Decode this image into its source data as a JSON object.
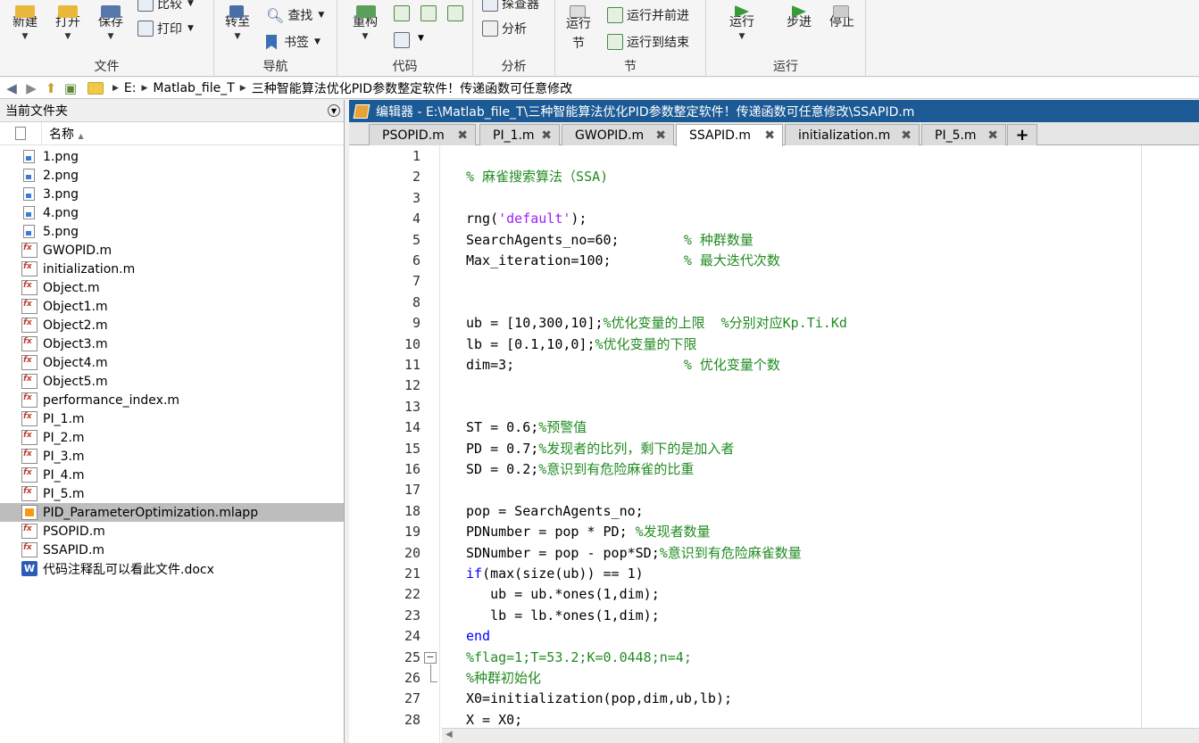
{
  "ribbon": {
    "groups": {
      "file": "文件",
      "navigate": "导航",
      "code": "代码",
      "analyze": "分析",
      "section": "节",
      "run": "运行"
    },
    "buttons": {
      "new": "新建",
      "open": "打开",
      "save": "保存",
      "compare": "比较",
      "print": "打印",
      "goto": "转至",
      "find": "查找",
      "bookmark": "书签",
      "refactor": "重构",
      "profiler": "探查器",
      "analyze": "分析",
      "run_section": "运行\n节",
      "run_advance": "运行并前进",
      "run_to_end": "运行到结束",
      "run": "运行",
      "step": "步进",
      "stop": "停止"
    }
  },
  "address": {
    "drive": "E:",
    "folder1": "Matlab_file_T",
    "folder2": "三种智能算法优化PID参数整定软件！传递函数可任意修改"
  },
  "left_panel": {
    "title": "当前文件夹",
    "name_col": "名称",
    "sort_indicator": "▲",
    "files": [
      {
        "name": "1.png",
        "type": "png"
      },
      {
        "name": "2.png",
        "type": "png"
      },
      {
        "name": "3.png",
        "type": "png"
      },
      {
        "name": "4.png",
        "type": "png"
      },
      {
        "name": "5.png",
        "type": "png"
      },
      {
        "name": "GWOPID.m",
        "type": "m"
      },
      {
        "name": "initialization.m",
        "type": "m"
      },
      {
        "name": "Object.m",
        "type": "m"
      },
      {
        "name": "Object1.m",
        "type": "m"
      },
      {
        "name": "Object2.m",
        "type": "m"
      },
      {
        "name": "Object3.m",
        "type": "m"
      },
      {
        "name": "Object4.m",
        "type": "m"
      },
      {
        "name": "Object5.m",
        "type": "m"
      },
      {
        "name": "performance_index.m",
        "type": "m"
      },
      {
        "name": "PI_1.m",
        "type": "m"
      },
      {
        "name": "PI_2.m",
        "type": "m"
      },
      {
        "name": "PI_3.m",
        "type": "m"
      },
      {
        "name": "PI_4.m",
        "type": "m"
      },
      {
        "name": "PI_5.m",
        "type": "m"
      },
      {
        "name": "PID_ParameterOptimization.mlapp",
        "type": "mlapp",
        "selected": true
      },
      {
        "name": "PSOPID.m",
        "type": "m"
      },
      {
        "name": "SSAPID.m",
        "type": "m"
      },
      {
        "name": "代码注释乱可以看此文件.docx",
        "type": "docx"
      }
    ]
  },
  "editor": {
    "title": "编辑器 - E:\\Matlab_file_T\\三种智能算法优化PID参数整定软件！传递函数可任意修改\\SSAPID.m",
    "tabs": [
      "PSOPID.m",
      "PI_1.m",
      "GWOPID.m",
      "SSAPID.m",
      "initialization.m",
      "PI_5.m"
    ],
    "active_tab": "SSAPID.m",
    "close_glyph": "✖",
    "add_tab": "+",
    "fold_glyph": "−",
    "line_numbers": [
      "1",
      "2",
      "3",
      "4",
      "5",
      "6",
      "7",
      "8",
      "9",
      "10",
      "11",
      "12",
      "13",
      "14",
      "15",
      "16",
      "17",
      "18",
      "19",
      "20",
      "21",
      "22",
      "23",
      "24",
      "25",
      "26",
      "27",
      "28"
    ],
    "code_lines": [
      [],
      [
        {
          "t": "% 麻雀搜索算法（SSA)",
          "c": "cm"
        }
      ],
      [],
      [
        {
          "t": "rng(",
          "c": ""
        },
        {
          "t": "'default'",
          "c": "str"
        },
        {
          "t": ");",
          "c": ""
        }
      ],
      [
        {
          "t": "SearchAgents_no=60;        ",
          "c": ""
        },
        {
          "t": "% 种群数量",
          "c": "cm"
        }
      ],
      [
        {
          "t": "Max_iteration=100;         ",
          "c": ""
        },
        {
          "t": "% 最大迭代次数",
          "c": "cm"
        }
      ],
      [],
      [],
      [
        {
          "t": "ub = [10,300,10];",
          "c": ""
        },
        {
          "t": "%优化变量的上限  %分别对应Kp.Ti.Kd",
          "c": "cm"
        }
      ],
      [
        {
          "t": "lb = [0.1,10,0];",
          "c": ""
        },
        {
          "t": "%优化变量的下限",
          "c": "cm"
        }
      ],
      [
        {
          "t": "dim=3;                     ",
          "c": ""
        },
        {
          "t": "% 优化变量个数",
          "c": "cm"
        }
      ],
      [],
      [],
      [
        {
          "t": "ST = 0.6;",
          "c": ""
        },
        {
          "t": "%预警值",
          "c": "cm"
        }
      ],
      [
        {
          "t": "PD = 0.7;",
          "c": ""
        },
        {
          "t": "%发现者的比列，剩下的是加入者",
          "c": "cm"
        }
      ],
      [
        {
          "t": "SD = 0.2;",
          "c": ""
        },
        {
          "t": "%意识到有危险麻雀的比重",
          "c": "cm"
        }
      ],
      [],
      [
        {
          "t": "pop = SearchAgents_no;",
          "c": ""
        }
      ],
      [
        {
          "t": "PDNumber = pop * PD; ",
          "c": ""
        },
        {
          "t": "%发现者数量",
          "c": "cm"
        }
      ],
      [
        {
          "t": "SDNumber = pop - pop*SD;",
          "c": ""
        },
        {
          "t": "%意识到有危险麻雀数量",
          "c": "cm"
        }
      ],
      [
        {
          "t": "if",
          "c": "kw"
        },
        {
          "t": "(max(size(ub)) == 1)",
          "c": ""
        }
      ],
      [
        {
          "t": "   ub = ub.*ones(1,dim);",
          "c": ""
        }
      ],
      [
        {
          "t": "   lb = lb.*ones(1,dim);",
          "c": ""
        }
      ],
      [
        {
          "t": "end",
          "c": "kw"
        }
      ],
      [
        {
          "t": "%flag=1;T=53.2;K=0.0448;n=4;",
          "c": "cm"
        }
      ],
      [
        {
          "t": "%种群初始化",
          "c": "cm"
        }
      ],
      [
        {
          "t": "X0=initialization(pop,dim,ub,lb);",
          "c": ""
        }
      ],
      [
        {
          "t": "X = X0;",
          "c": ""
        }
      ]
    ]
  }
}
